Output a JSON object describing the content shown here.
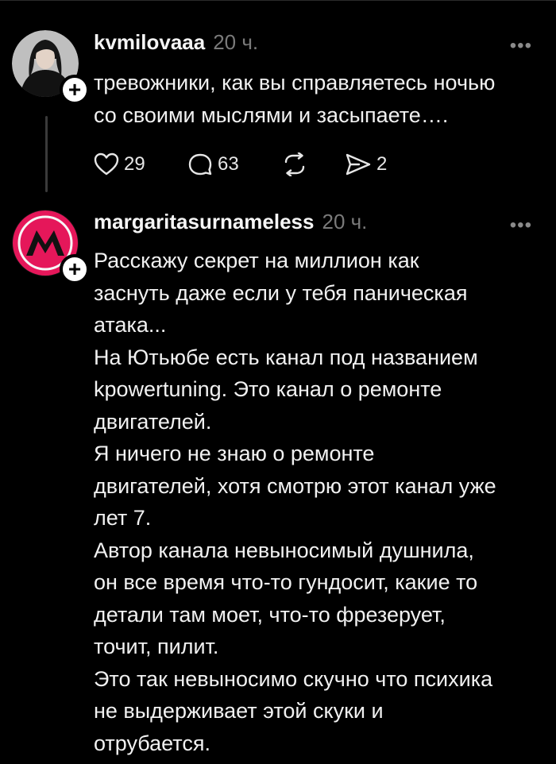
{
  "posts": [
    {
      "username": "kvmilovaaa",
      "timestamp": "20 ч.",
      "text": "тревожники, как вы справляетесь ночью\nсо своими мыслями и засыпаете….",
      "likes": "29",
      "comments": "63",
      "shares": "2",
      "avatar": "photo-avatar"
    },
    {
      "username": "margaritasurnameless",
      "timestamp": "20 ч.",
      "text": "Расскажу секрет на миллион как\nзаснуть даже если у тебя паническая\nатака...\nНа Ютьюбе есть канал под названием\nkpowertuning. Это канал о ремонте\nдвигателей.\nЯ ничего не знаю о ремонте\nдвигателей, хотя смотрю этот канал уже\nлет 7.\nАвтор канала невыносимый душнила,\nон все время что-то гундосит, какие то\nдетали там моет, что-то фрезерует,\nточит, пилит.\nЭто так невыносимо скучно что психика\nне выдерживает этой скуки и\nотрубается.",
      "avatar": "metro-logo-avatar",
      "avatar_letter": "M",
      "avatar_color": "#e5175a"
    }
  ],
  "icons": {
    "follow": "+",
    "more": "•••",
    "like": "heart-icon",
    "comment": "comment-icon",
    "repost": "repost-icon",
    "share": "send-icon"
  },
  "colors": {
    "background": "#000000",
    "text": "#f1f1f1",
    "muted": "#7a7a7a",
    "accent": "#e5175a"
  }
}
